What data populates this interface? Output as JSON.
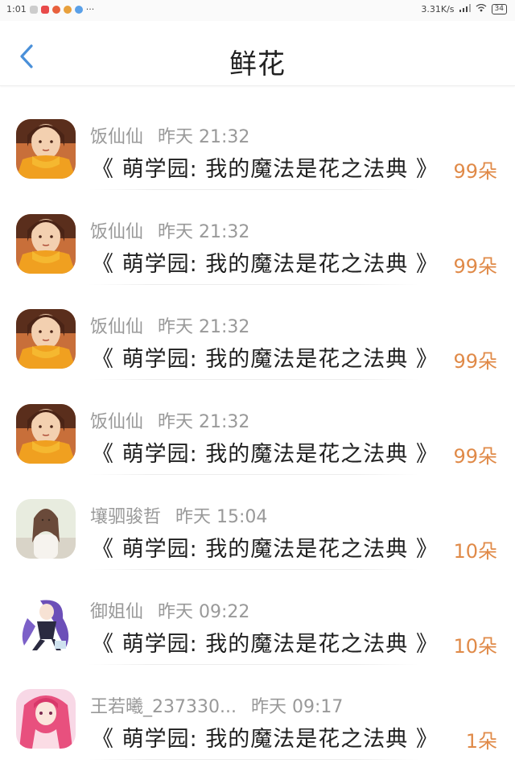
{
  "status_bar": {
    "time": "1:01",
    "dots": "···",
    "net_speed": "3.31K/s",
    "battery": "34"
  },
  "header": {
    "title": "鲜花",
    "back_icon": "chevron-left-icon",
    "accent_color": "#4a90d9"
  },
  "list": {
    "items": [
      {
        "user": "饭仙仙",
        "time": "昨天 21:32",
        "book": "《 萌学园: 我的魔法是花之法典 》",
        "flowers": "99朵",
        "avatar": "girl-orange-scarf"
      },
      {
        "user": "饭仙仙",
        "time": "昨天 21:32",
        "book": "《 萌学园: 我的魔法是花之法典 》",
        "flowers": "99朵",
        "avatar": "girl-orange-scarf"
      },
      {
        "user": "饭仙仙",
        "time": "昨天 21:32",
        "book": "《 萌学园: 我的魔法是花之法典 》",
        "flowers": "99朵",
        "avatar": "girl-orange-scarf"
      },
      {
        "user": "饭仙仙",
        "time": "昨天 21:32",
        "book": "《 萌学园: 我的魔法是花之法典 》",
        "flowers": "99朵",
        "avatar": "girl-orange-scarf"
      },
      {
        "user": "壤驷骏哲",
        "time": "昨天 15:04",
        "book": "《 萌学园: 我的魔法是花之法典 》",
        "flowers": "10朵",
        "avatar": "girl-photo"
      },
      {
        "user": "御姐仙",
        "time": "昨天 09:22",
        "book": "《 萌学园: 我的魔法是花之法典 》",
        "flowers": "10朵",
        "avatar": "anime-purple-hair"
      },
      {
        "user": "王若曦_237330...",
        "time": "昨天 09:17",
        "book": "《 萌学园: 我的魔法是花之法典 》",
        "flowers": "1朵",
        "avatar": "anime-pink-hair"
      }
    ]
  },
  "colors": {
    "flowers": "#e08a48",
    "meta": "#999999",
    "title": "#222222"
  }
}
